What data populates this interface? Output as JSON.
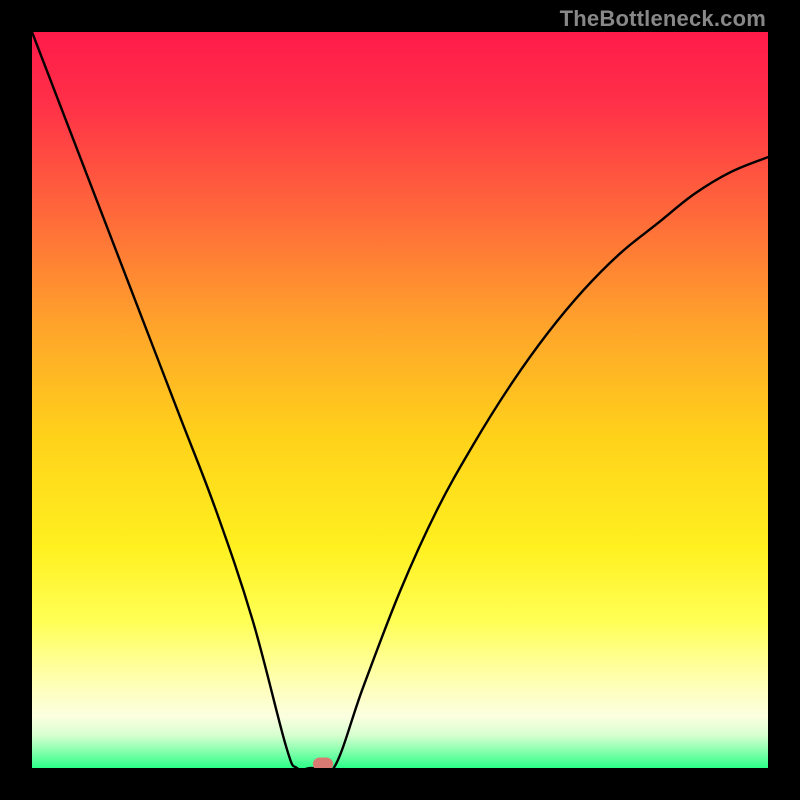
{
  "watermark": "TheBottleneck.com",
  "chart_data": {
    "type": "line",
    "title": "",
    "xlabel": "",
    "ylabel": "",
    "xlim": [
      0,
      100
    ],
    "ylim": [
      0,
      100
    ],
    "grid": false,
    "series": [
      {
        "name": "bottleneck-curve",
        "x": [
          0,
          5,
          10,
          15,
          20,
          25,
          30,
          34.5,
          36,
          38,
          41,
          45,
          50,
          55,
          60,
          65,
          70,
          75,
          80,
          85,
          90,
          95,
          100
        ],
        "values": [
          100,
          87,
          74,
          61,
          48,
          35,
          20,
          3,
          0,
          0,
          0,
          11,
          24,
          35,
          44,
          52,
          59,
          65,
          70,
          74,
          78,
          81,
          83
        ]
      }
    ],
    "annotations": [
      {
        "name": "min-marker",
        "x": 39.5,
        "y": 0.5,
        "color": "#d97a72"
      }
    ],
    "background_gradient": {
      "stops": [
        {
          "offset": 0.0,
          "color": "#ff1a4a"
        },
        {
          "offset": 0.1,
          "color": "#ff3148"
        },
        {
          "offset": 0.25,
          "color": "#ff6a3a"
        },
        {
          "offset": 0.4,
          "color": "#ffa42b"
        },
        {
          "offset": 0.55,
          "color": "#ffd21a"
        },
        {
          "offset": 0.7,
          "color": "#fff020"
        },
        {
          "offset": 0.8,
          "color": "#ffff55"
        },
        {
          "offset": 0.88,
          "color": "#ffffb0"
        },
        {
          "offset": 0.93,
          "color": "#fbffe0"
        },
        {
          "offset": 0.955,
          "color": "#d8ffd0"
        },
        {
          "offset": 0.975,
          "color": "#8fffb0"
        },
        {
          "offset": 1.0,
          "color": "#2bff89"
        }
      ]
    },
    "curve_style": {
      "stroke": "#000000",
      "width": 2.4
    }
  }
}
